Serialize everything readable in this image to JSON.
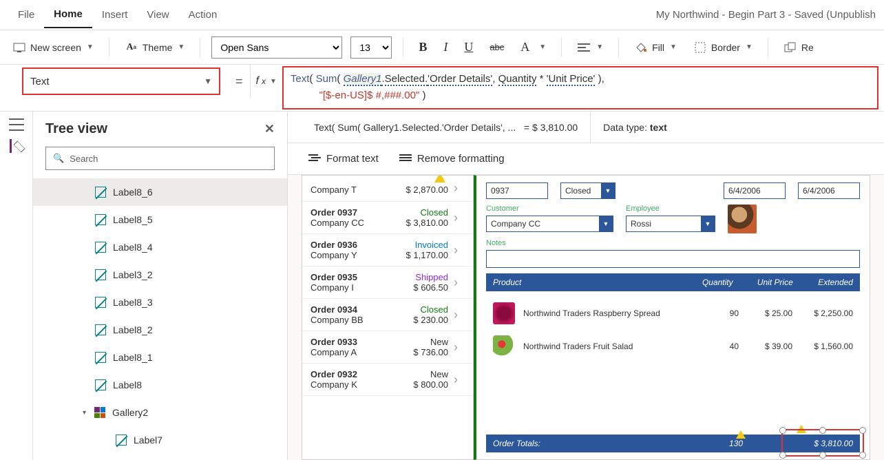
{
  "window": {
    "title": "My Northwind - Begin Part 3 - Saved (Unpublish"
  },
  "menu": {
    "file": "File",
    "home": "Home",
    "insert": "Insert",
    "view": "View",
    "action": "Action"
  },
  "ribbon": {
    "new_screen": "New screen",
    "theme": "Theme",
    "font_name": "Open Sans",
    "font_size": "13",
    "fill": "Fill",
    "border": "Border",
    "reorder": "Re"
  },
  "property": {
    "name": "Text",
    "equals": "="
  },
  "formula": {
    "fn_text": "Text",
    "op1": "( ",
    "fn_sum": "Sum",
    "op2": "( ",
    "id_gallery": "Gallery1",
    "dot1": ".Selected.",
    "od": "'Order Details'",
    "comma1": ", ",
    "qty": "Quantity",
    "times": " * ",
    "up": "'Unit Price'",
    "close1": " )",
    "comma2": ",",
    "indent": "          ",
    "fmt": "\"[$-en-US]$ #,###.00\"",
    "close2": " )"
  },
  "result": {
    "preview": "Text( Sum( Gallery1.Selected.'Order Details', ...",
    "equals": "=",
    "value": "$ 3,810.00",
    "datatype_label": "Data type:",
    "datatype": "text"
  },
  "fmtbar": {
    "format": "Format text",
    "remove": "Remove formatting"
  },
  "tree": {
    "title": "Tree view",
    "search_ph": "Search",
    "items": [
      {
        "label": "Label8_6",
        "type": "label",
        "sel": true
      },
      {
        "label": "Label8_5",
        "type": "label"
      },
      {
        "label": "Label8_4",
        "type": "label"
      },
      {
        "label": "Label3_2",
        "type": "label"
      },
      {
        "label": "Label8_3",
        "type": "label"
      },
      {
        "label": "Label8_2",
        "type": "label"
      },
      {
        "label": "Label8_1",
        "type": "label"
      },
      {
        "label": "Label8",
        "type": "label"
      },
      {
        "label": "Gallery2",
        "type": "gallery"
      },
      {
        "label": "Label7",
        "type": "label",
        "child": true
      }
    ]
  },
  "orders": [
    {
      "name": "",
      "company": "Company T",
      "amount": "$ 2,870.00",
      "status": "",
      "warn": true
    },
    {
      "name": "Order 0937",
      "company": "Company CC",
      "amount": "$ 3,810.00",
      "status": "Closed",
      "cls": "st-closed"
    },
    {
      "name": "Order 0936",
      "company": "Company Y",
      "amount": "$ 1,170.00",
      "status": "Invoiced",
      "cls": "st-invoiced"
    },
    {
      "name": "Order 0935",
      "company": "Company I",
      "amount": "$ 606.50",
      "status": "Shipped",
      "cls": "st-shipped"
    },
    {
      "name": "Order 0934",
      "company": "Company BB",
      "amount": "$ 230.00",
      "status": "Closed",
      "cls": "st-closed"
    },
    {
      "name": "Order 0933",
      "company": "Company A",
      "amount": "$ 736.00",
      "status": "New",
      "cls": "st-new"
    },
    {
      "name": "Order 0932",
      "company": "Company K",
      "amount": "$ 800.00",
      "status": "New",
      "cls": "st-new"
    }
  ],
  "detail": {
    "order_no": "0937",
    "status_label": "Closed",
    "date1": "6/4/2006",
    "date2": "6/4/2006",
    "customer_label": "Customer",
    "customer": "Company CC",
    "employee_label": "Employee",
    "employee": "Rossi",
    "notes_label": "Notes",
    "head": {
      "product": "Product",
      "qty": "Quantity",
      "price": "Unit Price",
      "ext": "Extended"
    },
    "products": [
      {
        "name": "Northwind Traders Raspberry Spread",
        "qty": "90",
        "price": "$ 25.00",
        "ext": "$ 2,250.00",
        "img": "berry"
      },
      {
        "name": "Northwind Traders Fruit Salad",
        "qty": "40",
        "price": "$ 39.00",
        "ext": "$ 1,560.00",
        "img": "salad"
      }
    ],
    "totals": {
      "label": "Order Totals:",
      "qty": "130",
      "price": "",
      "ext": "$ 3,810.00"
    }
  }
}
